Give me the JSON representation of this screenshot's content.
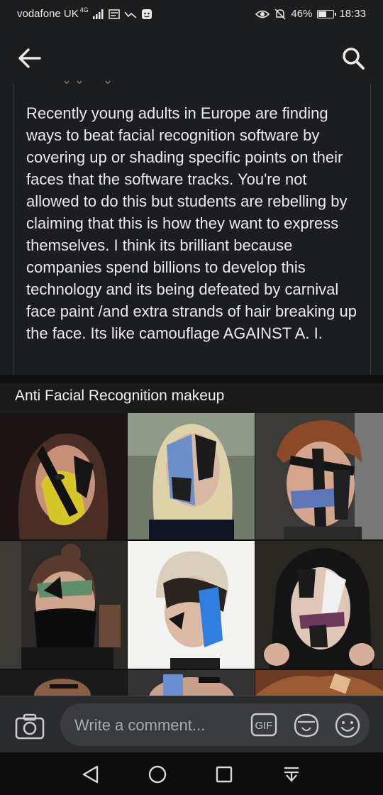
{
  "status_bar": {
    "carrier": "vodafone UK",
    "network": "4G",
    "battery_percent": "46%",
    "battery_level": 0.46,
    "time": "18:33"
  },
  "app_bar": {
    "back_icon": "arrow-left-icon",
    "search_icon": "search-icon"
  },
  "post": {
    "body": "Recently young adults in Europe are finding ways to beat facial recognition software by covering up or shading specific points on their faces that the software tracks. You're not allowed to do this but students are rebelling by claiming that this is how they want to express themselves. I think its brilliant because companies spend billions to develop this technology and its being defeated by carnival face paint /and extra strands of hair breaking up the face. Its like camouflage AGAINST A. I."
  },
  "image": {
    "caption": "Anti Facial Recognition makeup"
  },
  "comment_bar": {
    "placeholder": "Write a comment...",
    "gif_label": "GIF",
    "icons": [
      "camera-icon",
      "gif-icon",
      "sticker-icon",
      "emoji-icon"
    ]
  },
  "nav_bar": {
    "icons": [
      "back-triangle-icon",
      "home-circle-icon",
      "recents-square-icon",
      "notifications-pull-icon"
    ]
  },
  "colors": {
    "background": "#1c1d1f",
    "text": "#e9eaed",
    "comment_field": "#3a3b3d",
    "navbar": "#0d0d0e"
  }
}
